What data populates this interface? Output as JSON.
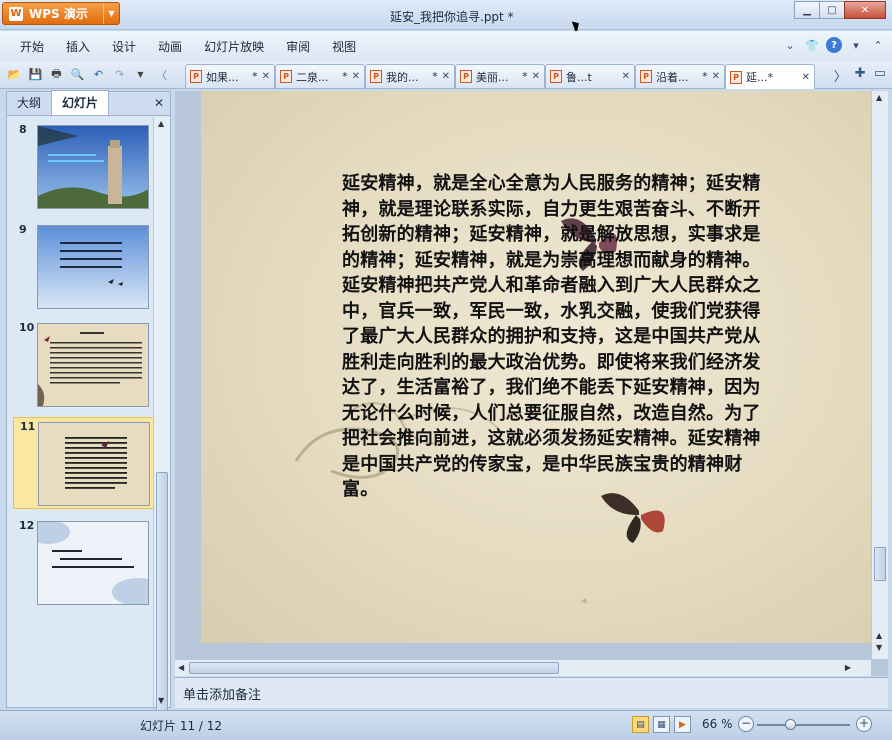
{
  "app": {
    "name": "WPS 演示",
    "logo": "W"
  },
  "document": {
    "title": "延安_我把你追寻.ppt *"
  },
  "menu": [
    "开始",
    "插入",
    "设计",
    "动画",
    "幻灯片放映",
    "审阅",
    "视图"
  ],
  "tabs": [
    {
      "label": "如果...",
      "mod": "*",
      "active": false
    },
    {
      "label": "二泉...",
      "mod": "*",
      "active": false
    },
    {
      "label": "我的...",
      "mod": "*",
      "active": false
    },
    {
      "label": "美丽...",
      "mod": "*",
      "active": false
    },
    {
      "label": "鲁...t",
      "mod": "",
      "active": false
    },
    {
      "label": "沿着...",
      "mod": "*",
      "active": false
    },
    {
      "label": "延...*",
      "mod": "",
      "active": true
    }
  ],
  "left_panel": {
    "tab_outline": "大纲",
    "tab_slides": "幻灯片",
    "thumbnails": [
      {
        "number": "8",
        "selected": false
      },
      {
        "number": "9",
        "selected": false
      },
      {
        "number": "10",
        "selected": false
      },
      {
        "number": "11",
        "selected": true
      },
      {
        "number": "12",
        "selected": false
      }
    ]
  },
  "slide": {
    "text": "延安精神，就是全心全意为人民服务的精神；延安精神，就是理论联系实际，自力更生艰苦奋斗、不断开拓创新的精神；延安精神，就是解放思想，实事求是的精神；延安精神，就是为崇高理想而献身的精神。延安精神把共产党人和革命者融入到广大人民群众之中，官兵一致，军民一致，水乳交融，使我们党获得了最广大人民群众的拥护和支持，这是中国共产党从胜利走向胜利的最大政治优势。即使将来我们经济发达了，生活富裕了，我们绝不能丢下延安精神，因为无论什么时候，人们总要征服自然，改造自然。为了把社会推向前进，这就必须发扬延安精神。延安精神是中国共产党的传家宝，是中华民族宝贵的精神财富。"
  },
  "notes": {
    "placeholder": "单击添加备注"
  },
  "status": {
    "slide_count": "幻灯片 11 / 12",
    "zoom": "66 %",
    "zoom_value": 0.36
  },
  "colors": {
    "accent": "#e06c10",
    "selection": "#fbe79f"
  }
}
